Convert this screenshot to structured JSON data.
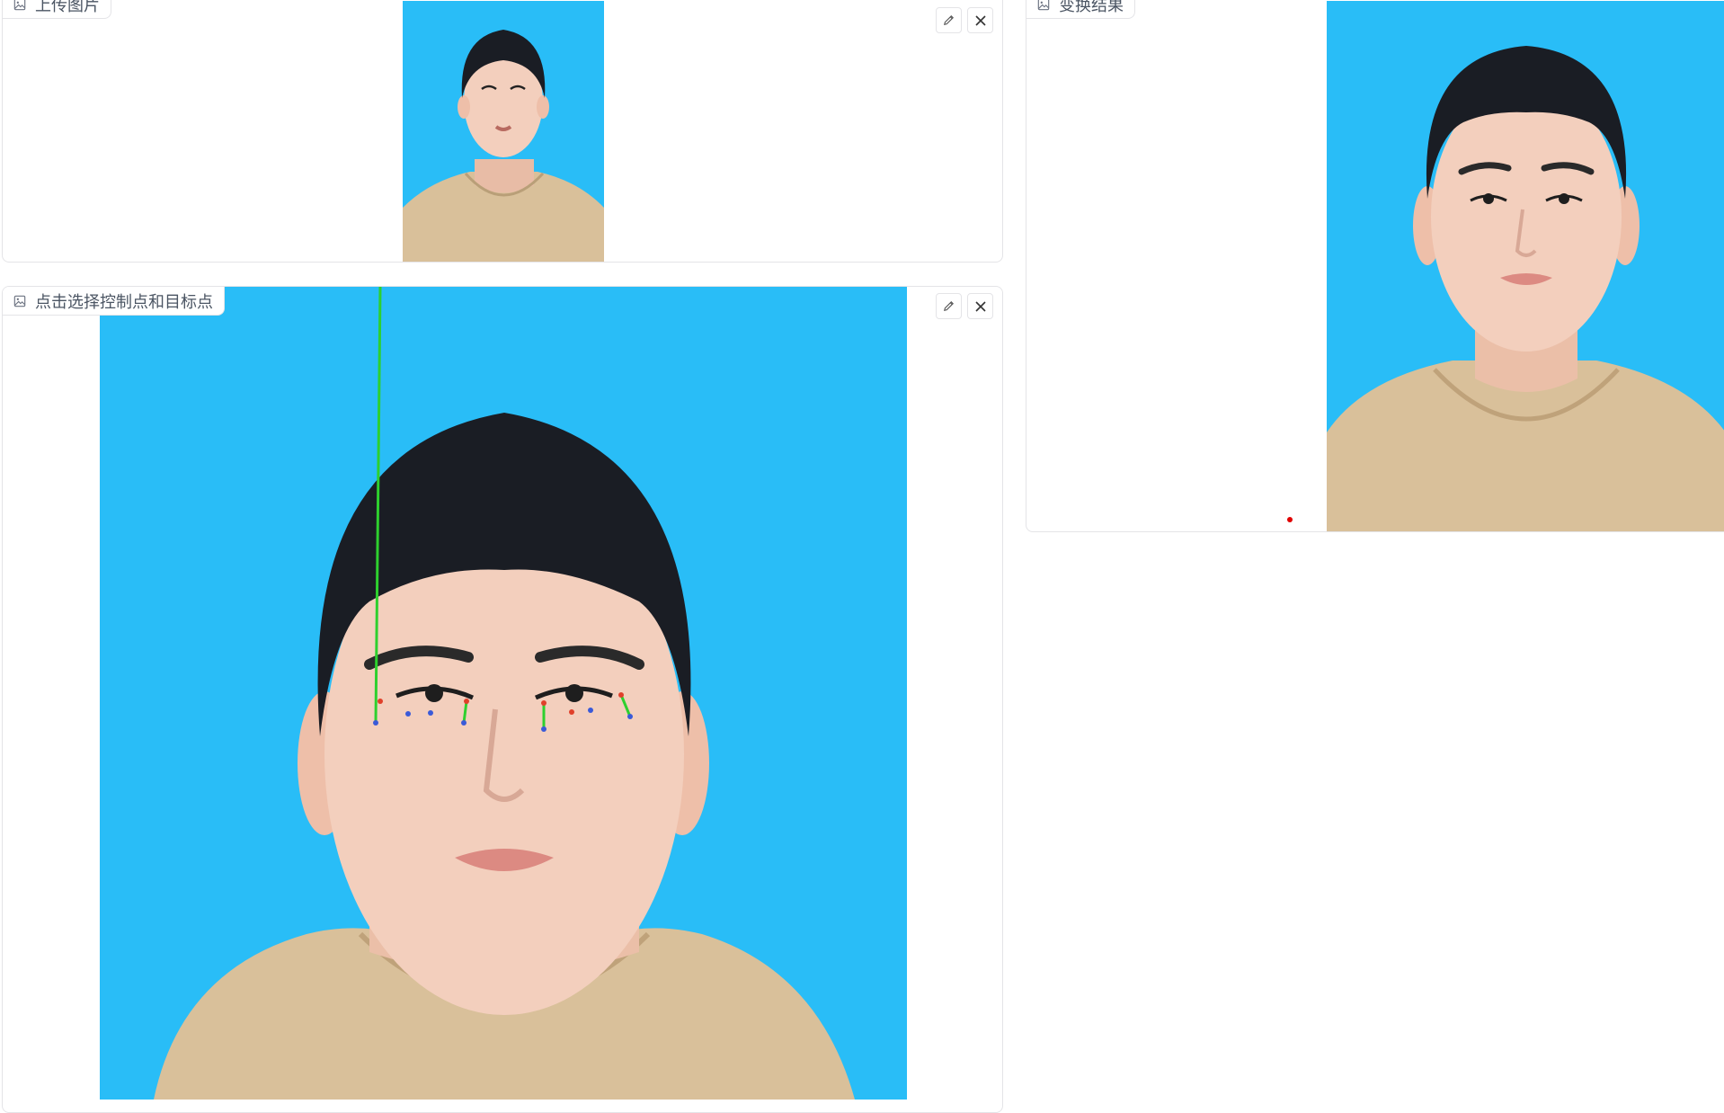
{
  "upload_panel": {
    "label": "上传图片",
    "label_icon": "image-icon",
    "edit_icon": "pencil-icon",
    "close_icon": "close-icon"
  },
  "select_panel": {
    "label": "点击选择控制点和目标点",
    "label_icon": "image-icon",
    "edit_icon": "pencil-icon",
    "close_icon": "close-icon"
  },
  "result_panel": {
    "label": "变换结果",
    "label_icon": "image-icon"
  },
  "colors": {
    "photo_background": "#29bdf7",
    "hoodie": "#d9c09a",
    "skin": "#f3cfbd",
    "hair": "#1a1d24",
    "control_point": "#e0402a",
    "target_point": "#3a5ad8",
    "drag_line": "#2ed02e",
    "marker": "#e00000"
  }
}
